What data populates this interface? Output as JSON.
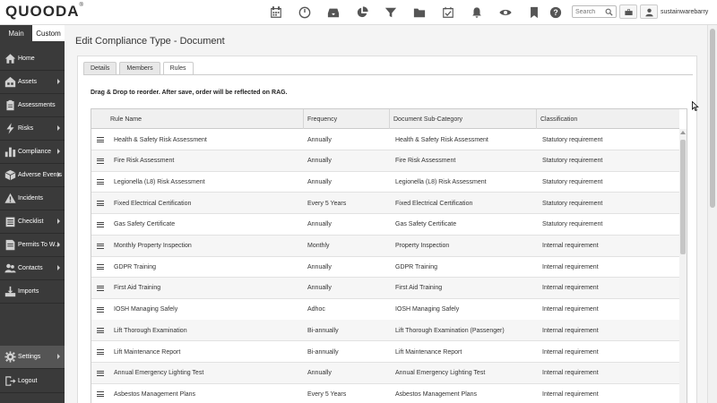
{
  "app": {
    "logo": "QUOODA",
    "logo_mark": "®",
    "username": "sustainwarebarry"
  },
  "topbar": {
    "icons": [
      "calendar-icon",
      "dashboard-gauge-icon",
      "inbox-icon",
      "pie-chart-icon",
      "filter-icon",
      "folder-icon",
      "calendar-check-icon",
      "bell-icon",
      "eye-icon",
      "bookmark-icon",
      "help-icon"
    ],
    "search_placeholder": "Search"
  },
  "sidebar": {
    "tabs": [
      {
        "label": "Main"
      },
      {
        "label": "Custom"
      }
    ],
    "items": [
      {
        "label": "Home",
        "icon": "home-icon",
        "has_arrow": false
      },
      {
        "label": "Assets",
        "icon": "assets-icon",
        "has_arrow": true
      },
      {
        "label": "Assessments",
        "icon": "clipboard-icon",
        "has_arrow": false
      },
      {
        "label": "Risks",
        "icon": "lightning-icon",
        "has_arrow": true
      },
      {
        "label": "Compliance",
        "icon": "bar-chart-icon",
        "has_arrow": true
      },
      {
        "label": "Adverse Events",
        "icon": "cube-icon",
        "has_arrow": true
      },
      {
        "label": "Incidents",
        "icon": "warning-icon",
        "has_arrow": false
      },
      {
        "label": "Checklist",
        "icon": "checklist-icon",
        "has_arrow": true
      },
      {
        "label": "Permits To W...",
        "icon": "permit-icon",
        "has_arrow": true
      },
      {
        "label": "Contacts",
        "icon": "contacts-icon",
        "has_arrow": true
      },
      {
        "label": "Imports",
        "icon": "imports-icon",
        "has_arrow": false
      }
    ],
    "settings": {
      "label": "Settings",
      "icon": "gear-icon"
    },
    "logout": {
      "label": "Logout",
      "icon": "logout-icon"
    }
  },
  "page": {
    "title": "Edit Compliance Type - Document",
    "tabs": [
      {
        "label": "Details"
      },
      {
        "label": "Members"
      },
      {
        "label": "Rules"
      }
    ],
    "active_tab": "Rules",
    "note": "Drag & Drop to reorder. After save, order will be reflected on RAG."
  },
  "grid": {
    "columns": [
      "Rule Name",
      "Frequency",
      "Document Sub-Category",
      "Classification"
    ],
    "rows": [
      [
        "Health & Safety Risk Assessment",
        "Annually",
        "Health & Safety Risk Assessment",
        "Statutory requirement"
      ],
      [
        "Fire Risk Assessment",
        "Annually",
        "Fire Risk Assessment",
        "Statutory requirement"
      ],
      [
        "Legionella (L8) Risk Assessment",
        "Annually",
        "Legionella (L8) Risk Assessment",
        "Statutory requirement"
      ],
      [
        "Fixed Electrical Certification",
        "Every 5 Years",
        "Fixed Electrical Certification",
        "Statutory requirement"
      ],
      [
        "Gas Safety Certificate",
        "Annually",
        "Gas Safety Certificate",
        "Statutory requirement"
      ],
      [
        "Monthly Property Inspection",
        "Monthly",
        "Property Inspection",
        "Internal requirement"
      ],
      [
        "GDPR Training",
        "Annually",
        "GDPR Training",
        "Internal requirement"
      ],
      [
        "First Aid Training",
        "Annually",
        "First Aid Training",
        "Internal requirement"
      ],
      [
        "IOSH Managing Safely",
        "Adhoc",
        "IOSH Managing Safely",
        "Internal requirement"
      ],
      [
        "Lift Thorough Examination",
        "Bi-annually",
        "Lift Thorough Examination (Passenger)",
        "Internal requirement"
      ],
      [
        "Lift Maintenance Report",
        "Bi-annually",
        "Lift Maintenance Report",
        "Internal requirement"
      ],
      [
        "Annual Emergency Lighting Test",
        "Annually",
        "Annual Emergency Lighting Test",
        "Internal requirement"
      ],
      [
        "Asbestos Management Plans",
        "Every 5 Years",
        "Asbestos Management Plans",
        "Internal requirement"
      ]
    ]
  }
}
